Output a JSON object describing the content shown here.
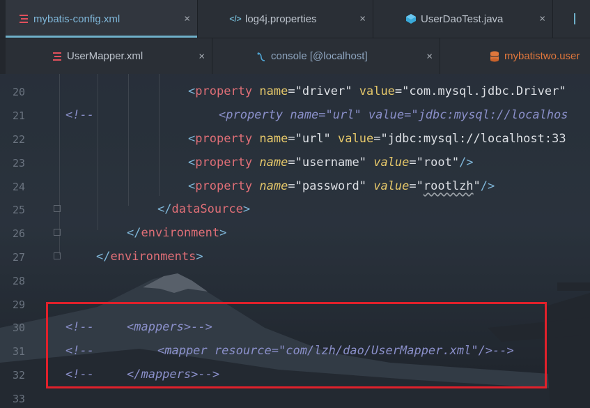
{
  "editor": {
    "tabs_row1": [
      {
        "label": "mybatis-config.xml",
        "icon": "xml-config-icon",
        "active": true
      },
      {
        "label": "log4j.properties",
        "icon": "properties-icon",
        "active": false
      },
      {
        "label": "UserDaoTest.java",
        "icon": "java-class-icon",
        "active": false
      }
    ],
    "tabs_row2": [
      {
        "label": "UserMapper.xml",
        "icon": "xml-mapper-icon"
      },
      {
        "label": "console [@localhost]",
        "icon": "console-icon"
      },
      {
        "label": "mybatistwo.user",
        "icon": "database-table-icon"
      }
    ],
    "line_numbers": [
      "20",
      "21",
      "22",
      "23",
      "24",
      "25",
      "26",
      "27",
      "28",
      "29",
      "30",
      "31",
      "32",
      "33"
    ],
    "code": {
      "l20": {
        "open": "<",
        "tag": "property",
        "a1": "name",
        "v1": "\"driver\"",
        "a2": "value",
        "v2": "\"com.mysql.jdbc.Driver\""
      },
      "l21": {
        "comment": "<!--",
        "body": "<property name=\"url\" value=\"jdbc:mysql://localhos"
      },
      "l22": {
        "tag": "property",
        "a1": "name",
        "v1": "\"url\"",
        "a2": "value",
        "v2": "\"jdbc:mysql://localhost:33"
      },
      "l23": {
        "tag": "property",
        "a1": "name",
        "v1": "\"username\"",
        "a2": "value",
        "v2": "\"root\"",
        "end": "/>"
      },
      "l24": {
        "tag": "property",
        "a1": "name",
        "v1": "\"password\"",
        "a2": "value",
        "v2a": "\"",
        "v2b": "rootlzh",
        "v2c": "\"",
        "end": "/>"
      },
      "l25": {
        "tag": "dataSource"
      },
      "l26": {
        "tag": "environment"
      },
      "l27": {
        "tag": "environments"
      },
      "l30": {
        "comment": "<!--",
        "body": "<mappers>-->"
      },
      "l31": {
        "comment": "<!--",
        "body": "<mapper resource=\"com/lzh/dao/UserMapper.xml\"/>-->"
      },
      "l32": {
        "comment": "<!--",
        "body": "</mappers>-->"
      }
    },
    "close_symbol": "×"
  }
}
